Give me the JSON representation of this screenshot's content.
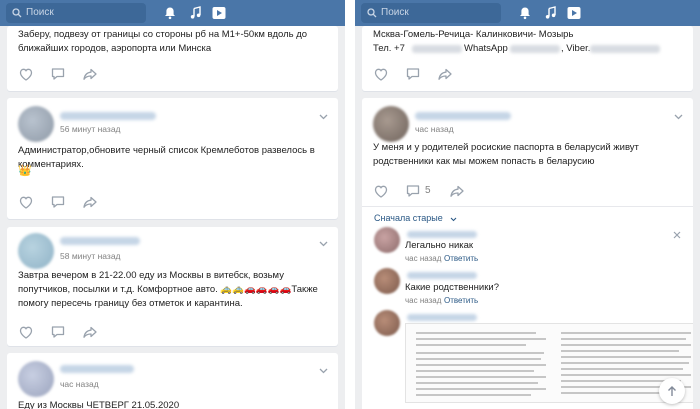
{
  "topbar": {
    "search_placeholder": "Поиск",
    "accent": "#4a76a8"
  },
  "left": {
    "post1": {
      "text": "Заберу, подвезу от границы со стороны рб на М1+-50км вдоль до ближайших городов, аэропорта или Минска"
    },
    "post2": {
      "time": "56 минут назад",
      "text": "Администратор,обновите черный список Кремлеботов развелось в комментариях.",
      "emoji": "👑"
    },
    "post3": {
      "time": "58 минут назад",
      "text": "Завтра вечером в 21-22.00 еду из Москвы в витебск, возьму попутчиков, посылки и т.д. Комфортное авто. 🚕🚕🚗🚗🚗🚗Также помогу пересечь границу без отметок и карантина."
    },
    "post4": {
      "time": "час назад",
      "text": "Еду из Москвы ЧЕТВЕРГ 21.05.2020"
    }
  },
  "right": {
    "post1": {
      "line1": "Мсква-Гомель-Речица- Калинковичи- Мозырь",
      "line2": "Тел. +7",
      "line2_b": "WhatsApp",
      "line2_c": ", Viber."
    },
    "post2": {
      "time": "час назад",
      "text": "У меня и у родителей росиские паспорта в беларусий живут родственники как мы можем попасть в беларусию",
      "comment_count": "5"
    },
    "older_comments": "Сначала старые",
    "comments": [
      {
        "text": "Легально никак",
        "time": "час назад",
        "reply": "Ответить"
      },
      {
        "text": "Какие родственники?",
        "time": "час назад",
        "reply": "Ответить"
      }
    ]
  }
}
